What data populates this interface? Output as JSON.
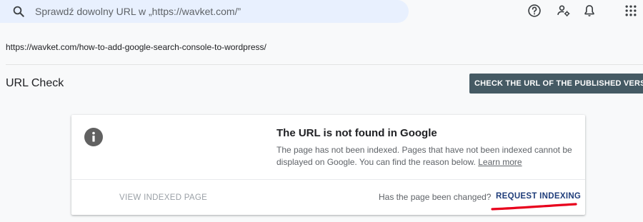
{
  "search": {
    "placeholder": "Sprawdź dowolny URL w „https://wavket.com/”",
    "icon": "search-icon"
  },
  "topbar_icons": [
    "help-icon",
    "manage-users-icon",
    "notifications-bell-icon",
    "apps-grid-icon"
  ],
  "inspected_url": "https://wavket.com/how-to-add-google-search-console-to-wordpress/",
  "page_title": "URL Check",
  "check_button_label": "CHECK THE URL OF THE PUBLISHED VERSION",
  "status_card": {
    "icon": "info-icon",
    "title": "The URL is not found in Google",
    "description": "The page has not been indexed. Pages that have not been indexed cannot be displayed on Google. You can find the reason below.",
    "learn_more": "Learn more",
    "view_indexed_label": "VIEW INDEXED PAGE",
    "changed_question": "Has the page been changed?",
    "request_indexing_label": "REQUEST INDEXING"
  },
  "colors": {
    "search_bg": "#e8f0fe",
    "button_bg": "#455a64",
    "request_link": "#1f3d7a",
    "annotation_underline": "#e8001c"
  }
}
